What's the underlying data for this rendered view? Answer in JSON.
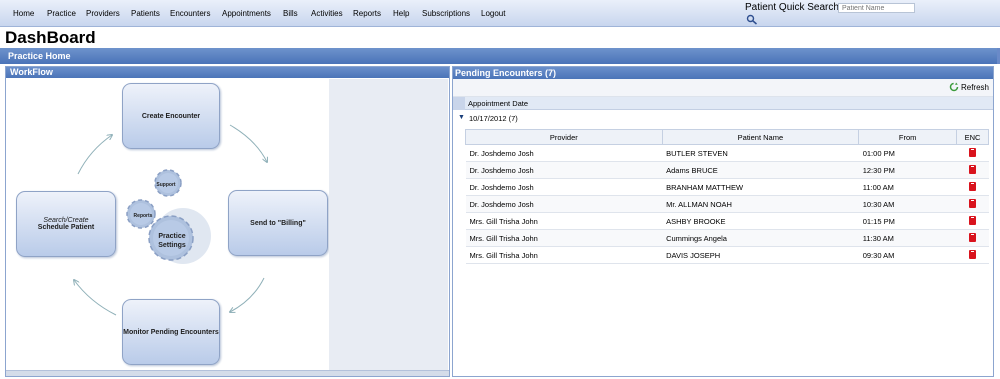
{
  "nav": {
    "items": [
      "Home",
      "Practice",
      "Providers",
      "Patients",
      "Encounters",
      "Appointments",
      "Bills",
      "Activities",
      "Reports",
      "Help",
      "Subscriptions",
      "Logout"
    ],
    "quick_search_label": "Patient Quick Search:",
    "quick_search_placeholder": "Patient Name"
  },
  "page_title": "DashBoard",
  "section_title": "Practice Home",
  "workflow": {
    "title": "WorkFlow",
    "create_encounter": "Create Encounter",
    "send_billing": "Send to \"Billing\"",
    "monitor": "Monitor Pending Encounters",
    "search_create": "Search/Create",
    "schedule": "Schedule Patient",
    "gear_support": "Support",
    "gear_reports": "Reports",
    "gear_practice": "Practice",
    "gear_settings": "Settings"
  },
  "encounters": {
    "title": "Pending Encounters (7)",
    "refresh_label": "Refresh",
    "group_by_label": "Appointment Date",
    "group_label": "10/17/2012 (7)",
    "columns": [
      "Provider",
      "Patient Name",
      "From",
      "ENC"
    ],
    "rows": [
      {
        "provider": "Dr. Joshdemo Josh",
        "patient": "BUTLER STEVEN",
        "from": "01:00 PM"
      },
      {
        "provider": "Dr. Joshdemo Josh",
        "patient": "Adams BRUCE",
        "from": "12:30 PM"
      },
      {
        "provider": "Dr. Joshdemo Josh",
        "patient": "BRANHAM MATTHEW",
        "from": "11:00 AM"
      },
      {
        "provider": "Dr. Joshdemo Josh",
        "patient": "Mr. ALLMAN NOAH",
        "from": "10:30 AM"
      },
      {
        "provider": "Mrs. Gill Trisha John",
        "patient": "ASHBY BROOKE",
        "from": "01:15 PM"
      },
      {
        "provider": "Mrs. Gill Trisha John",
        "patient": "Cummings Angela",
        "from": "11:30 AM"
      },
      {
        "provider": "Mrs. Gill Trisha John",
        "patient": "DAVIS JOSEPH",
        "from": "09:30 AM"
      }
    ]
  },
  "colors": {
    "header_blue": "#4a73b8",
    "enc_icon_red": "#d9131d"
  }
}
